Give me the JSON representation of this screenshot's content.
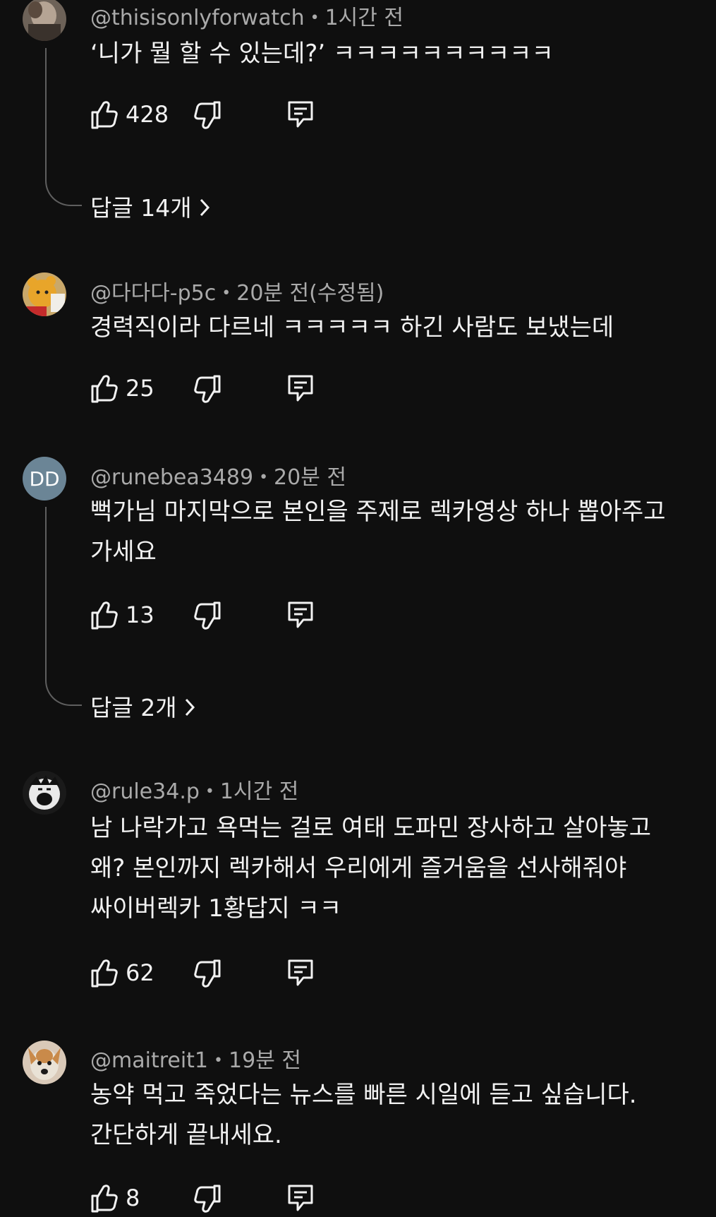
{
  "comments": [
    {
      "author": "@thisisonlyforwatch",
      "time": "1시간 전",
      "lines": [
        "‘니가 뭘 할 수 있는데?’ ㅋㅋㅋㅋㅋㅋㅋㅋㅋㅋ"
      ],
      "likes": "428",
      "replies": "답글 14개",
      "avatar_icon": "user-photo-avatar"
    },
    {
      "author": "@다다다-p5c",
      "time": "20분 전(수정됨)",
      "lines": [
        "경력직이라 다르네 ㅋㅋㅋㅋㅋ 하긴 사람도 보냈는데"
      ],
      "likes": "25",
      "avatar_icon": "cartoon-bear-avatar"
    },
    {
      "author": "@runebea3489",
      "time": "20분 전",
      "lines": [
        "뻑가님 마지막으로 본인을 주제로 렉카영상 하나 뽑아주고",
        "가세요"
      ],
      "likes": "13",
      "replies": "답글 2개",
      "avatar_initials": "DD",
      "avatar_color": "#6b8596"
    },
    {
      "author": "@rule34.p",
      "time": "1시간 전",
      "lines": [
        "남 나락가고 욕먹는 걸로 여태 도파민 장사하고 살아놓고",
        "왜? 본인까지 렉카해서 우리에게 즐거움을 선사해줘야",
        "싸이버렉카 1황답지 ㅋㅋ"
      ],
      "likes": "62",
      "avatar_icon": "manga-face-avatar"
    },
    {
      "author": "@maitreit1",
      "time": "19분 전",
      "lines": [
        "농약 먹고 죽었다는 뉴스를 빠른 시일에 듣고 싶습니다.",
        "간단하게 끝내세요."
      ],
      "likes": "8",
      "avatar_icon": "dog-avatar"
    }
  ],
  "meta_separator": "•",
  "icons": {
    "like": "thumbs-up-icon",
    "dislike": "thumbs-down-icon",
    "reply": "reply-comment-icon",
    "chevron": "chevron-right-icon"
  }
}
